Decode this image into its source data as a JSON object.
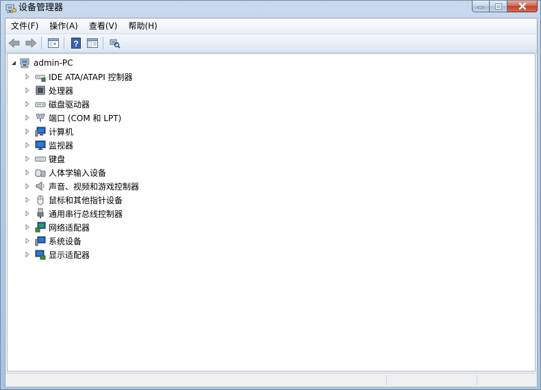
{
  "window": {
    "title": "设备管理器"
  },
  "menu": [
    {
      "label": "文件(F)"
    },
    {
      "label": "操作(A)"
    },
    {
      "label": "查看(V)"
    },
    {
      "label": "帮助(H)"
    }
  ],
  "toolbar": [
    {
      "name": "back-button",
      "icon": "back-arrow-icon"
    },
    {
      "name": "forward-button",
      "icon": "forward-arrow-icon"
    },
    {
      "name": "show-hide-console-tree-button",
      "icon": "console-tree-icon"
    },
    {
      "name": "help-button",
      "icon": "help-icon"
    },
    {
      "name": "properties-button",
      "icon": "properties-icon"
    },
    {
      "name": "scan-hardware-button",
      "icon": "scan-hardware-icon"
    }
  ],
  "tree": {
    "root": {
      "label": "admin-PC",
      "icon": "computer-icon",
      "expanded": true
    },
    "items": [
      {
        "label": "IDE ATA/ATAPI 控制器",
        "icon": "ide-controller-icon"
      },
      {
        "label": "处理器",
        "icon": "processor-icon"
      },
      {
        "label": "磁盘驱动器",
        "icon": "disk-drive-icon"
      },
      {
        "label": "端口 (COM 和 LPT)",
        "icon": "port-icon"
      },
      {
        "label": "计算机",
        "icon": "computer-monitor-icon"
      },
      {
        "label": "监视器",
        "icon": "monitor-icon"
      },
      {
        "label": "键盘",
        "icon": "keyboard-icon"
      },
      {
        "label": "人体学输入设备",
        "icon": "hid-icon"
      },
      {
        "label": "声音、视频和游戏控制器",
        "icon": "speaker-icon"
      },
      {
        "label": "鼠标和其他指针设备",
        "icon": "mouse-icon"
      },
      {
        "label": "通用串行总线控制器",
        "icon": "usb-icon"
      },
      {
        "label": "网络适配器",
        "icon": "network-adapter-icon"
      },
      {
        "label": "系统设备",
        "icon": "system-devices-icon"
      },
      {
        "label": "显示适配器",
        "icon": "display-adapter-icon"
      }
    ]
  },
  "status": {
    "text": ""
  }
}
